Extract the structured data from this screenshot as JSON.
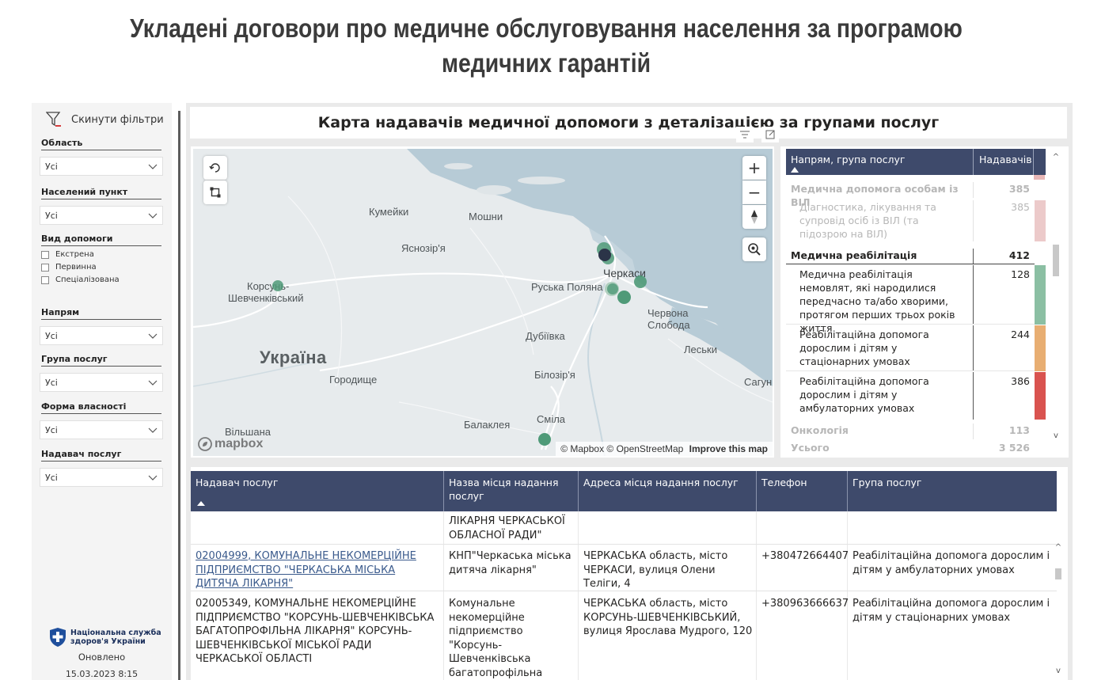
{
  "page": {
    "title": "Укладені договори про медичне обслуговування населення за програмою медичних гарантій"
  },
  "sidebar": {
    "reset_label": "Скинути фільтри",
    "filters": [
      {
        "label": "Область",
        "value": "Усі"
      },
      {
        "label": "Населений пункт",
        "value": "Усі"
      },
      {
        "label": "Напрям",
        "value": "Усі"
      },
      {
        "label": "Група послуг",
        "value": "Усі"
      },
      {
        "label": "Форма власності",
        "value": "Усі"
      },
      {
        "label": "Надавач послуг",
        "value": "Усі"
      }
    ],
    "care_type": {
      "label": "Вид допомоги",
      "options": [
        "Екстрена",
        "Первинна",
        "Спеціалізована"
      ]
    },
    "org_name": [
      "Національна служба",
      "здоров'я України"
    ],
    "updated_label": "Оновлено",
    "updated_value": "15.03.2023 8:15"
  },
  "card": {
    "title": "Карта надавачів медичної допомоги з деталізацією за групами послуг"
  },
  "map": {
    "places": {
      "kumeyky": "Кумейки",
      "moshny": "Мошни",
      "yasnozirya": "Яснозір'я",
      "korsun": [
        "Корсунь-",
        "Шевченківський"
      ],
      "rus_polyana": "Руська Поляна",
      "cherkasy": "Черкаси",
      "chervona": [
        "Червона",
        "Слобода"
      ],
      "dubiivka": "Дубіївка",
      "ukraina": "Україна",
      "lesky": "Леськи",
      "horodyshche": "Городище",
      "bilozirya": "Білозір'я",
      "sahunivka": "Сагуні",
      "smila": "Сміла",
      "balakleya": "Балаклея",
      "vilshana": "Вільшана"
    },
    "logo": "mapbox",
    "attribution": "© Mapbox © OpenStreetMap",
    "improve": "Improve this map",
    "zoom_in": "+",
    "zoom_out": "−"
  },
  "matrix": {
    "header": {
      "col1": "Напрям, група послуг",
      "col2": "Надавачів"
    },
    "rows": [
      {
        "label": "Медична допомога особам із ВІЛ",
        "value": "385"
      },
      {
        "label": "Діагностика, лікування та супровід осіб із ВІЛ (та підозрою на ВІЛ)",
        "value": "385"
      },
      {
        "label": "Медична реабілітація",
        "value": "412"
      },
      {
        "label": "Медична реабілітація немовлят, які народилися передчасно та/або хворими, протягом перших трьох років життя",
        "value": "128"
      },
      {
        "label": "Реабілітаційна допомога дорослим і дітям у стаціонарних умовах",
        "value": "244"
      },
      {
        "label": "Реабілітаційна допомога дорослим і дітям у амбулаторних умовах",
        "value": "386"
      },
      {
        "label": "Онкологія",
        "value": "113"
      },
      {
        "label": "Усього",
        "value": "3 526"
      }
    ],
    "bar_colors": [
      "#e8b7b7",
      "#8bbfa3",
      "#e8ae72",
      "#d9534f"
    ]
  },
  "table": {
    "headers": [
      "Надавач послуг",
      "Назва місця надання послуг",
      "Адреса місця надання послуг",
      "Телефон",
      "Група послуг"
    ],
    "partial_row": {
      "place": "ПСИХІАТРИЧНА ЛІКАРНЯ ЧЕРКАСЬКОЇ ОБЛАСНОЇ РАДИ\""
    },
    "rows": [
      {
        "provider": "02004999, КОМУНАЛЬНЕ НЕКОМЕРЦІЙНЕ ПІДПРИЄМСТВО \"ЧЕРКАСЬКА МІСЬКА ДИТЯЧА ЛІКАРНЯ\"",
        "place": "КНП\"Черкаська міська дитяча лікарня\"",
        "address": "ЧЕРКАСЬКА область, місто ЧЕРКАСИ, вулиця Олени Теліги, 4",
        "phone": "+380472664407",
        "group": "Реабілітаційна допомога дорослим і дітям у амбулаторних умовах"
      },
      {
        "provider": "02005349, КОМУНАЛЬНЕ НЕКОМЕРЦІЙНЕ ПІДПРИЄМСТВО \"КОРСУНЬ-ШЕВЧЕНКІВСЬКА БАГАТОПРОФІЛЬНА ЛІКАРНЯ\" КОРСУНЬ-ШЕВЧЕНКІВСЬКОЇ МІСЬКОЇ РАДИ ЧЕРКАСЬКОЇ ОБЛАСТІ",
        "place": "Комунальне некомерційне підприємство \"Корсунь-Шевченківська багатопрофільна лікарня\" Корсунь-",
        "address": "ЧЕРКАСЬКА область, місто КОРСУНЬ-ШЕВЧЕНКІВСЬКИЙ, вулиця Ярослава Мудрого, 120",
        "phone": "+380963666637",
        "group": "Реабілітаційна допомога дорослим і дітям у стаціонарних умовах"
      }
    ]
  },
  "colors": {
    "header_bg": "#3e4a6b",
    "map_water": "#b7cbd6",
    "dot_green": "#4f9a78",
    "dot_dark": "#2b3448"
  }
}
